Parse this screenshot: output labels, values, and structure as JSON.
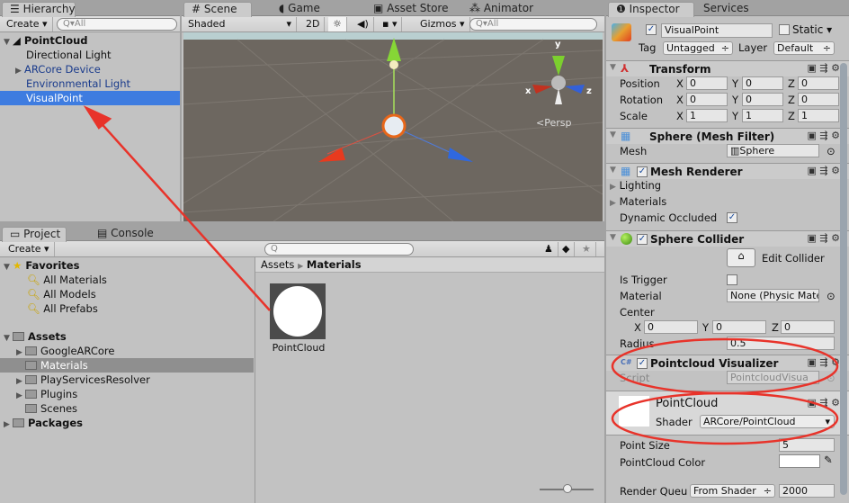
{
  "hierarchy": {
    "tab": "Hierarchy",
    "create": "Create",
    "search_placeholder": "All",
    "root": "PointCloud",
    "items": [
      "Directional Light",
      "ARCore Device",
      "Environmental Light",
      "VisualPoint"
    ],
    "selected": "VisualPoint"
  },
  "scene": {
    "tabs": [
      "Scene",
      "Game",
      "Asset Store",
      "Animator"
    ],
    "shading": "Shaded",
    "mode_2d": "2D",
    "gizmos": "Gizmos",
    "search_placeholder": "All",
    "projection": "Persp",
    "axes": {
      "x": "x",
      "y": "y",
      "z": "z"
    }
  },
  "project": {
    "tabs": [
      "Project",
      "Console"
    ],
    "create": "Create",
    "favorites": {
      "label": "Favorites",
      "items": [
        "All Materials",
        "All Models",
        "All Prefabs"
      ]
    },
    "assets": {
      "label": "Assets",
      "items": [
        "GoogleARCore",
        "Materials",
        "PlayServicesResolver",
        "Plugins",
        "Scenes"
      ]
    },
    "packages": "Packages",
    "breadcrumb": [
      "Assets",
      "Materials"
    ],
    "selected_folder": "Materials",
    "files": [
      "PointCloud"
    ]
  },
  "inspector": {
    "tabs": [
      "Inspector",
      "Services"
    ],
    "object_name": "VisualPoint",
    "active": true,
    "static_label": "Static",
    "static": false,
    "tag_label": "Tag",
    "tag": "Untagged",
    "layer_label": "Layer",
    "layer": "Default",
    "transform": {
      "title": "Transform",
      "rows": [
        {
          "label": "Position",
          "x": "0",
          "y": "0",
          "z": "0"
        },
        {
          "label": "Rotation",
          "x": "0",
          "y": "0",
          "z": "0"
        },
        {
          "label": "Scale",
          "x": "1",
          "y": "1",
          "z": "1"
        }
      ]
    },
    "mesh_filter": {
      "title": "Sphere (Mesh Filter)",
      "mesh_label": "Mesh",
      "mesh": "Sphere"
    },
    "mesh_renderer": {
      "title": "Mesh Renderer",
      "lighting": "Lighting",
      "materials": "Materials",
      "dynamic_occluded": "Dynamic Occluded",
      "dynamic_occluded_checked": true
    },
    "sphere_collider": {
      "title": "Sphere Collider",
      "edit_collider": "Edit Collider",
      "is_trigger": "Is Trigger",
      "is_trigger_checked": false,
      "material_label": "Material",
      "material": "None (Physic Mate",
      "center": "Center",
      "cx": "0",
      "cy": "0",
      "cz": "0",
      "radius_label": "Radius",
      "radius": "0.5"
    },
    "visualizer": {
      "title": "Pointcloud Visualizer",
      "script_label": "Script",
      "script": "PointcloudVisua"
    },
    "material": {
      "name": "PointCloud",
      "shader_label": "Shader",
      "shader": "ARCore/PointCloud",
      "point_size_label": "Point Size",
      "point_size": "5",
      "color_label": "PointCloud Color",
      "color": "#ffffff",
      "render_queue_label": "Render Queu",
      "render_queue_mode": "From Shader",
      "render_queue": "2000"
    }
  },
  "annotation_color": "#e8332a"
}
